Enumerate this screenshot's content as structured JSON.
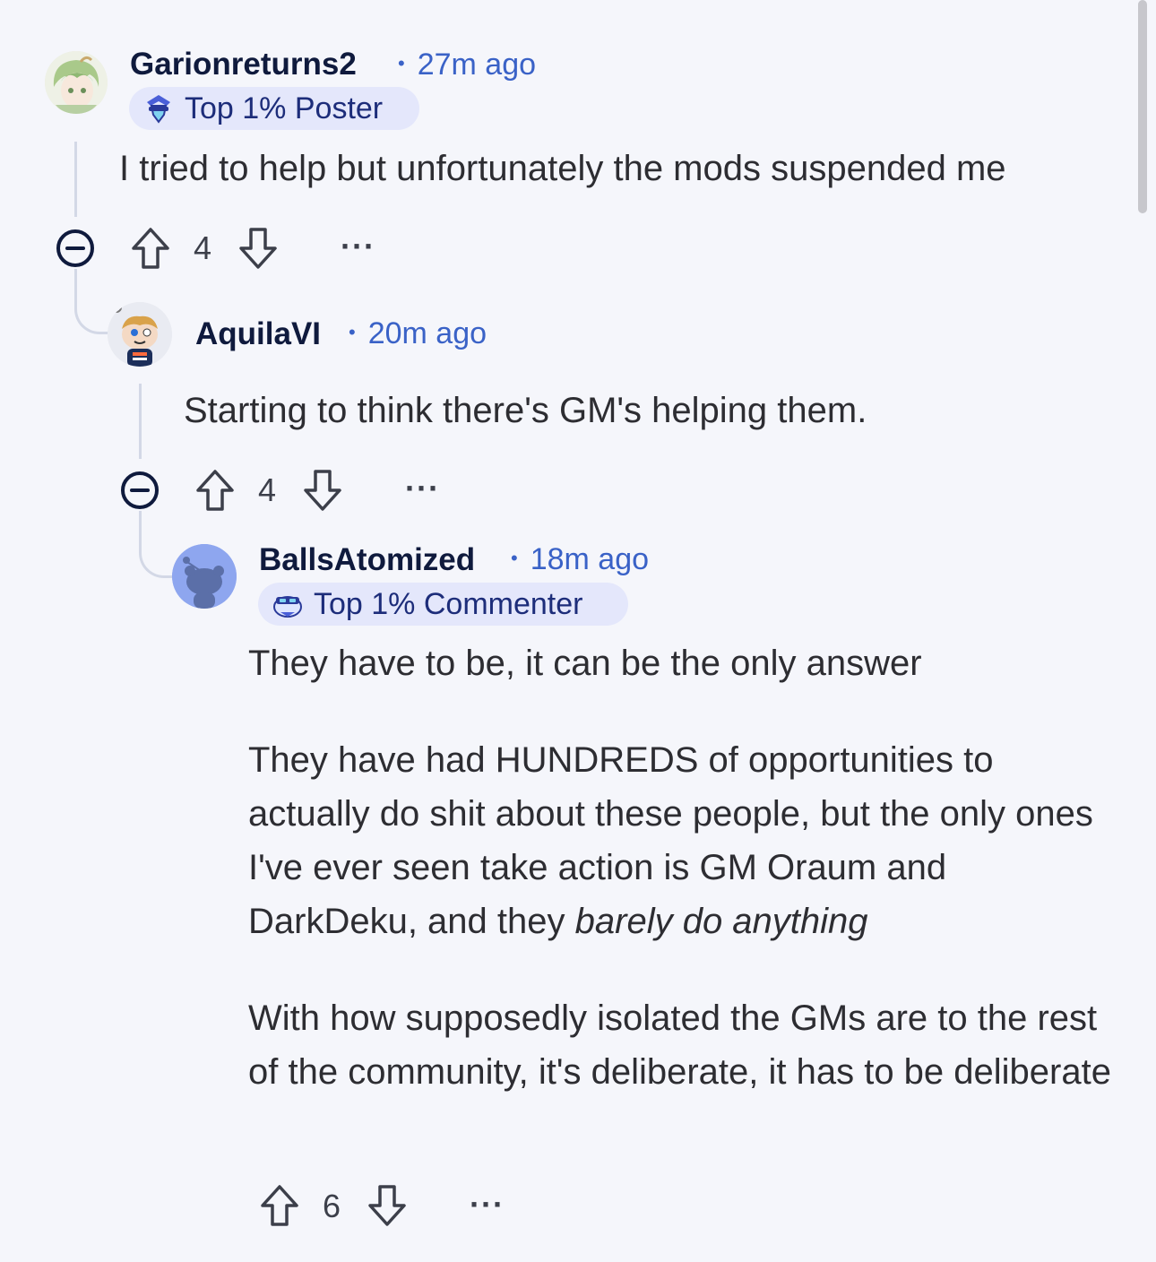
{
  "colors": {
    "background": "#f5f6fb",
    "username": "#0f1a3d",
    "timestamp": "#3a62c7",
    "flair_bg": "#e4e7fb",
    "flair_text": "#1d2d7a",
    "thread_line": "#d3d8e6"
  },
  "comments": [
    {
      "username": "Garionreturns2",
      "timestamp": "27m ago",
      "flair": {
        "label": "Top 1% Poster",
        "icon": "top-poster-icon"
      },
      "avatar_icon": "green-hair-anime-avatar",
      "body": [
        "I tried to help but unfortunately the mods suspended me"
      ],
      "votes": "4",
      "more": "···"
    },
    {
      "username": "AquilaVI",
      "timestamp": "20m ago",
      "avatar_icon": "snoo-cartoon-avatar",
      "body": [
        "Starting to think there's GM's helping them."
      ],
      "votes": "4",
      "more": "···"
    },
    {
      "username": "BallsAtomized",
      "timestamp": "18m ago",
      "flair": {
        "label": "Top 1% Commenter",
        "icon": "top-commenter-icon"
      },
      "avatar_icon": "default-snoo-avatar",
      "body": [
        "They have to be, it can be the only answer",
        "They have had HUNDREDS of opportunities to actually do shit about these people, but the only ones I've ever seen take action is GM Oraum and DarkDeku, and they ",
        "barely do anything",
        "With how supposedly isolated the GMs are to the rest of the community, it's deliberate, it has to be deliberate"
      ],
      "votes": "6",
      "more": "···"
    }
  ]
}
